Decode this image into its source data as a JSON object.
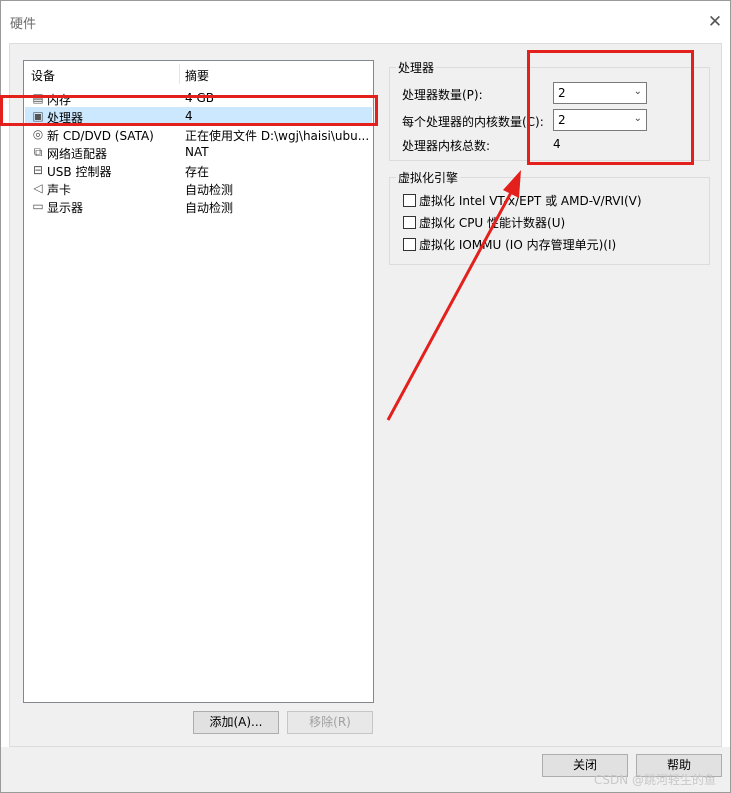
{
  "window": {
    "title": "硬件",
    "close_glyph": "✕"
  },
  "device_list": {
    "header_device": "设备",
    "header_summary": "摘要",
    "items": [
      {
        "name": "内存",
        "summary": "4 GB",
        "icon": "memory-icon"
      },
      {
        "name": "处理器",
        "summary": "4",
        "icon": "cpu-icon"
      },
      {
        "name": "新 CD/DVD (SATA)",
        "summary": "正在使用文件 D:\\wgj\\haisi\\ubu...",
        "icon": "cd-dvd-icon"
      },
      {
        "name": "网络适配器",
        "summary": "NAT",
        "icon": "network-adapter-icon"
      },
      {
        "name": "USB 控制器",
        "summary": "存在",
        "icon": "usb-icon"
      },
      {
        "name": "声卡",
        "summary": "自动检测",
        "icon": "sound-card-icon"
      },
      {
        "name": "显示器",
        "summary": "自动检测",
        "icon": "display-icon"
      }
    ],
    "selected": "处理器"
  },
  "list_buttons": {
    "add": "添加(A)...",
    "remove": "移除(R)"
  },
  "processor": {
    "group_title": "处理器",
    "count_label": "处理器数量(P):",
    "count_value": "2",
    "cores_label": "每个处理器的内核数量(C):",
    "cores_value": "2",
    "total_label": "处理器内核总数:",
    "total_value": "4"
  },
  "virtualization": {
    "group_title": "虚拟化引擎",
    "options": [
      {
        "label": "虚拟化 Intel VT-x/EPT 或 AMD-V/RVI(V)",
        "checked": false
      },
      {
        "label": "虚拟化 CPU 性能计数器(U)",
        "checked": false
      },
      {
        "label": "虚拟化 IOMMU (IO 内存管理单元)(I)",
        "checked": false
      }
    ]
  },
  "footer_buttons": {
    "close": "关闭",
    "help": "帮助"
  },
  "watermark": "CSDN @跳河轻生的鱼",
  "annotation_color": "#e3201b"
}
